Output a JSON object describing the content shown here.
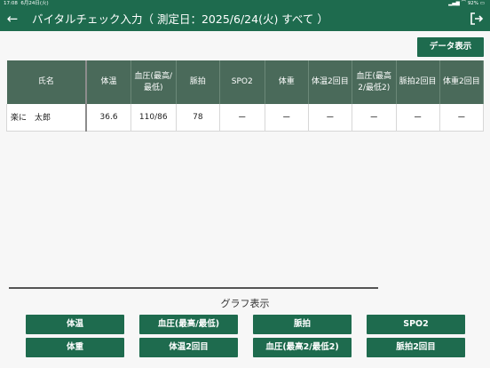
{
  "status": {
    "time": "17:08",
    "date": "6月24日(火)",
    "battery": "92%"
  },
  "appbar": {
    "title": "バイタルチェック入力（ 測定日：2025/6/24(火) すべて ）"
  },
  "buttons": {
    "data_display": "データ表示"
  },
  "table": {
    "headers": [
      "氏名",
      "体温",
      "血圧(最高/最低)",
      "脈拍",
      "SPO2",
      "体重",
      "体温2回目",
      "血圧(最高2/最低2)",
      "脈拍2回目",
      "体重2回目"
    ],
    "rows": [
      [
        "楽に　太郎",
        "36.6",
        "110/86",
        "78",
        "ー",
        "ー",
        "ー",
        "ー",
        "ー",
        "ー"
      ]
    ]
  },
  "graph": {
    "label": "グラフ表示",
    "buttons": [
      "体温",
      "血圧(最高/最低)",
      "脈拍",
      "SPO2",
      "体重",
      "体温2回目",
      "血圧(最高2/最低2)",
      "脈拍2回目"
    ]
  },
  "colors": {
    "accent": "#1e6b4e",
    "table_header": "#4a6a5a"
  }
}
